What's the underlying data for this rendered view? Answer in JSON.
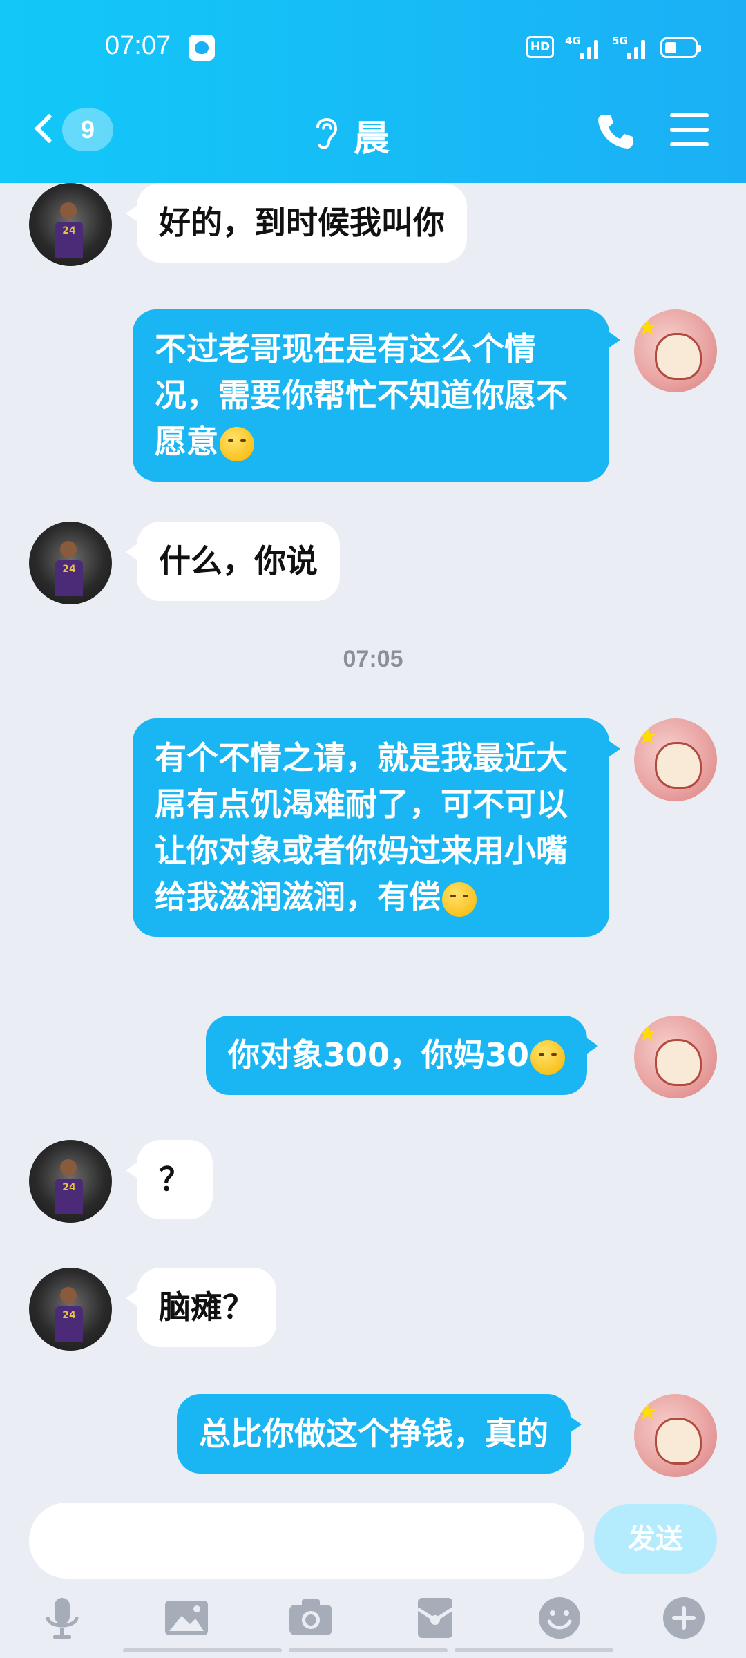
{
  "status_bar": {
    "time": "07:07",
    "hd_label": "HD",
    "signal_1": "4G",
    "signal_2": "5G",
    "icons": [
      "baidu-icon",
      "hd-icon",
      "signal-icon",
      "battery-icon"
    ]
  },
  "header": {
    "unread_count": "9",
    "contact_name": "晨",
    "icons": [
      "back-icon",
      "ear-icon",
      "phone-icon",
      "menu-icon"
    ],
    "colors": {
      "bar_start": "#12c8f8",
      "bar_end": "#1bb0f5"
    }
  },
  "messages": [
    {
      "side": "in",
      "text": "好的，到时候我叫你"
    },
    {
      "side": "out",
      "text": "不过老哥现在是有这么个情况，需要你帮忙不知道你愿不愿意",
      "emoji": "pensive-emoji"
    },
    {
      "side": "in",
      "text": "什么，你说"
    },
    {
      "side": "time",
      "text": "07:05"
    },
    {
      "side": "out",
      "text": "有个不情之请，就是我最近大屌有点饥渴难耐了，可不可以让你对象或者你妈过来用小嘴给我滋润滋润，有偿",
      "emoji": "grin-emoji"
    },
    {
      "side": "out",
      "text": "你对象300，你妈30",
      "emoji": "grin-emoji"
    },
    {
      "side": "in",
      "text": "？"
    },
    {
      "side": "in",
      "text": "脑瘫？"
    },
    {
      "side": "out",
      "text": "总比你做这个挣钱，真的"
    }
  ],
  "input": {
    "value": "",
    "placeholder": ""
  },
  "send_label": "发送",
  "toolbar_icons": [
    "microphone-icon",
    "image-icon",
    "camera-icon",
    "red-packet-icon",
    "emoji-icon",
    "plus-icon"
  ],
  "colors": {
    "outgoing_bubble": "#1ab6f4",
    "incoming_bubble": "#ffffff",
    "background": "#eaedf4",
    "send_button": "#b5ecfd"
  }
}
